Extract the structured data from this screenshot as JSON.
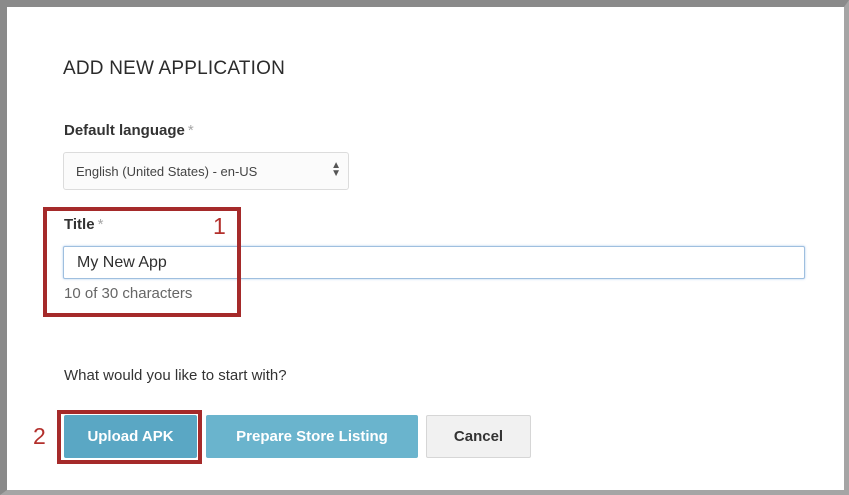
{
  "dialog": {
    "title": "ADD NEW APPLICATION"
  },
  "default_language": {
    "label": "Default language",
    "required_marker": "*",
    "selected": "English (United States) - en-US"
  },
  "title_field": {
    "label": "Title",
    "required_marker": "*",
    "value": "My New App",
    "char_count": "10 of 30 characters"
  },
  "start_prompt": "What would you like to start with?",
  "buttons": {
    "upload_apk": "Upload APK",
    "prepare_store_listing": "Prepare Store Listing",
    "cancel": "Cancel"
  },
  "annotations": {
    "marker_1": "1",
    "marker_2": "2",
    "color": "#a52a2a"
  },
  "colors": {
    "primary_button": "#5aa7c4",
    "secondary_button": "#6ab4cd"
  }
}
